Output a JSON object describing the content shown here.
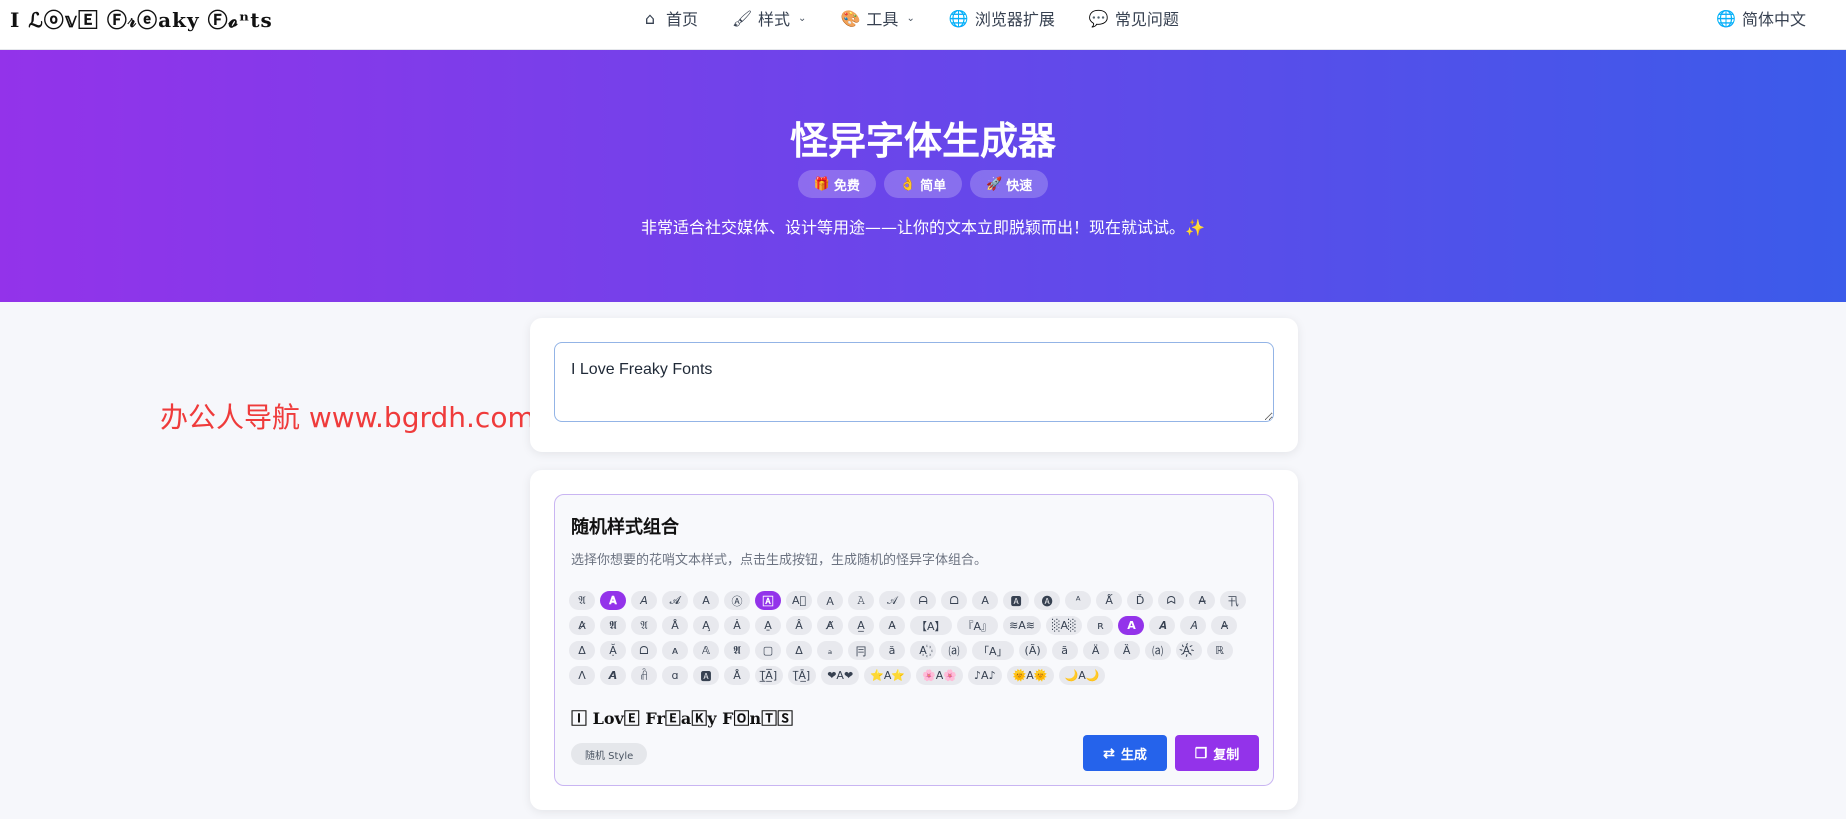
{
  "header": {
    "logo": "I ℒⓞ𝕧🄴 Ⓕ𝓇ⓔ𝐚𝐤𝐲 Ⓕ𝓸ⁿ𝐭𝐬",
    "nav": [
      {
        "icon": "home-icon",
        "glyph": "⌂",
        "label": "首页",
        "dropdown": false
      },
      {
        "icon": "brush-icon",
        "glyph": "🖌",
        "label": "样式",
        "dropdown": true
      },
      {
        "icon": "palette-icon",
        "glyph": "🎨",
        "label": "工具",
        "dropdown": true
      },
      {
        "icon": "globe-icon",
        "glyph": "🌐",
        "label": "浏览器扩展",
        "dropdown": false
      },
      {
        "icon": "chat-icon",
        "glyph": "💬",
        "label": "常见问题",
        "dropdown": false
      }
    ],
    "language": {
      "icon": "globe-icon",
      "glyph": "🌐",
      "label": "简体中文"
    }
  },
  "hero": {
    "title": "怪异字体生成器",
    "badges": [
      {
        "icon": "gift-icon",
        "glyph": "🎁",
        "label": "免费"
      },
      {
        "icon": "ok-hand-icon",
        "glyph": "👌",
        "label": "简单"
      },
      {
        "icon": "rocket-icon",
        "glyph": "🚀",
        "label": "快速"
      }
    ],
    "subtitle": "非常适合社交媒体、设计等用途——让你的文本立即脱颖而出！现在就试试。✨"
  },
  "watermark": "办公人导航 www.bgrdh.com",
  "input": {
    "value": "I Love Freaky Fonts"
  },
  "generator": {
    "title": "随机样式组合",
    "description": "选择你想要的花哨文本样式，点击生成按钮，生成随机的怪异字体组合。",
    "chips": [
      {
        "label": "𝔄",
        "active": false
      },
      {
        "label": "𝐀",
        "active": true
      },
      {
        "label": "𝘈",
        "active": false
      },
      {
        "label": "𝓐",
        "active": false
      },
      {
        "label": "𝖠",
        "active": false
      },
      {
        "label": "Ⓐ",
        "active": false
      },
      {
        "label": "🄰",
        "active": true
      },
      {
        "label": "A⃞",
        "active": false
      },
      {
        "label": "Ａ",
        "active": false
      },
      {
        "label": "𝙰",
        "active": false
      },
      {
        "label": "𝒜",
        "active": false
      },
      {
        "label": "ᗩ",
        "active": false
      },
      {
        "label": "ᗝ",
        "active": false
      },
      {
        "label": "Α",
        "active": false
      },
      {
        "label": "🅰",
        "active": false
      },
      {
        "label": "🅐",
        "active": false
      },
      {
        "label": "ᴬ",
        "active": false
      },
      {
        "label": "Ǻ",
        "active": false
      },
      {
        "label": "Ď",
        "active": false
      },
      {
        "label": "ᗣ",
        "active": false
      },
      {
        "label": "A̶",
        "active": false
      },
      {
        "label": "卂",
        "active": false
      },
      {
        "label": "A̷",
        "active": false
      },
      {
        "label": "𝕬",
        "active": false
      },
      {
        "label": "𝔄",
        "active": false
      },
      {
        "label": "Å",
        "active": false
      },
      {
        "label": "A̧",
        "active": false
      },
      {
        "label": "Ȧ",
        "active": false
      },
      {
        "label": "A̱",
        "active": false
      },
      {
        "label": "Â",
        "active": false
      },
      {
        "label": "A̸",
        "active": false
      },
      {
        "label": "A̲",
        "active": false
      },
      {
        "label": "A̵",
        "active": false
      },
      {
        "label": "【A】",
        "active": false
      },
      {
        "label": "『A』",
        "active": false
      },
      {
        "label": "≋A≋",
        "active": false
      },
      {
        "label": "░A░",
        "active": false
      },
      {
        "label": "ʀ",
        "active": false
      },
      {
        "label": "A",
        "active": true
      },
      {
        "label": "𝑨",
        "active": false
      },
      {
        "label": "𝐴",
        "active": false
      },
      {
        "label": "A̴",
        "active": false
      },
      {
        "label": "Δ",
        "active": false
      },
      {
        "label": "Ặ",
        "active": false
      },
      {
        "label": "ᗝ",
        "active": false
      },
      {
        "label": "ᴀ",
        "active": false
      },
      {
        "label": "𝔸",
        "active": false
      },
      {
        "label": "𝕬",
        "active": false
      },
      {
        "label": "▢",
        "active": false
      },
      {
        "label": "Δ",
        "active": false
      },
      {
        "label": "ₐ",
        "active": false
      },
      {
        "label": "冃",
        "active": false
      },
      {
        "label": "ă",
        "active": false
      },
      {
        "label": "A꙰",
        "active": false
      },
      {
        "label": "⒜",
        "active": false
      },
      {
        "label": "「A」",
        "active": false
      },
      {
        "label": "(Ã)",
        "active": false
      },
      {
        "label": "ã",
        "active": false
      },
      {
        "label": "Ä",
        "active": false
      },
      {
        "label": "Ȁ",
        "active": false
      },
      {
        "label": "⒜",
        "active": false
      },
      {
        "label": "A҉",
        "active": false
      },
      {
        "label": "ℝ",
        "active": false
      },
      {
        "label": "Λ",
        "active": false
      },
      {
        "label": "𝘼",
        "active": false
      },
      {
        "label": "ꋫ",
        "active": false
      },
      {
        "label": "ɑ",
        "active": false
      },
      {
        "label": "🅰",
        "active": false
      },
      {
        "label": "Å",
        "active": false
      },
      {
        "label": "[̲̅A̲̅]",
        "active": false
      },
      {
        "label": "[̅Ā̲]",
        "active": false
      },
      {
        "label": "❤A❤",
        "active": false
      },
      {
        "label": "⭐A⭐",
        "active": false
      },
      {
        "label": "🌸A🌸",
        "active": false
      },
      {
        "label": "♪A♪",
        "active": false
      },
      {
        "label": "🌞A🌞",
        "active": false
      },
      {
        "label": "🌙A🌙",
        "active": false
      }
    ],
    "preview": "🄸 Lov🄴 Fr🄴a🄺y F🄾n🅃🅂",
    "style_tag": "随机 Style",
    "generate_label": "生成",
    "copy_label": "复制"
  }
}
